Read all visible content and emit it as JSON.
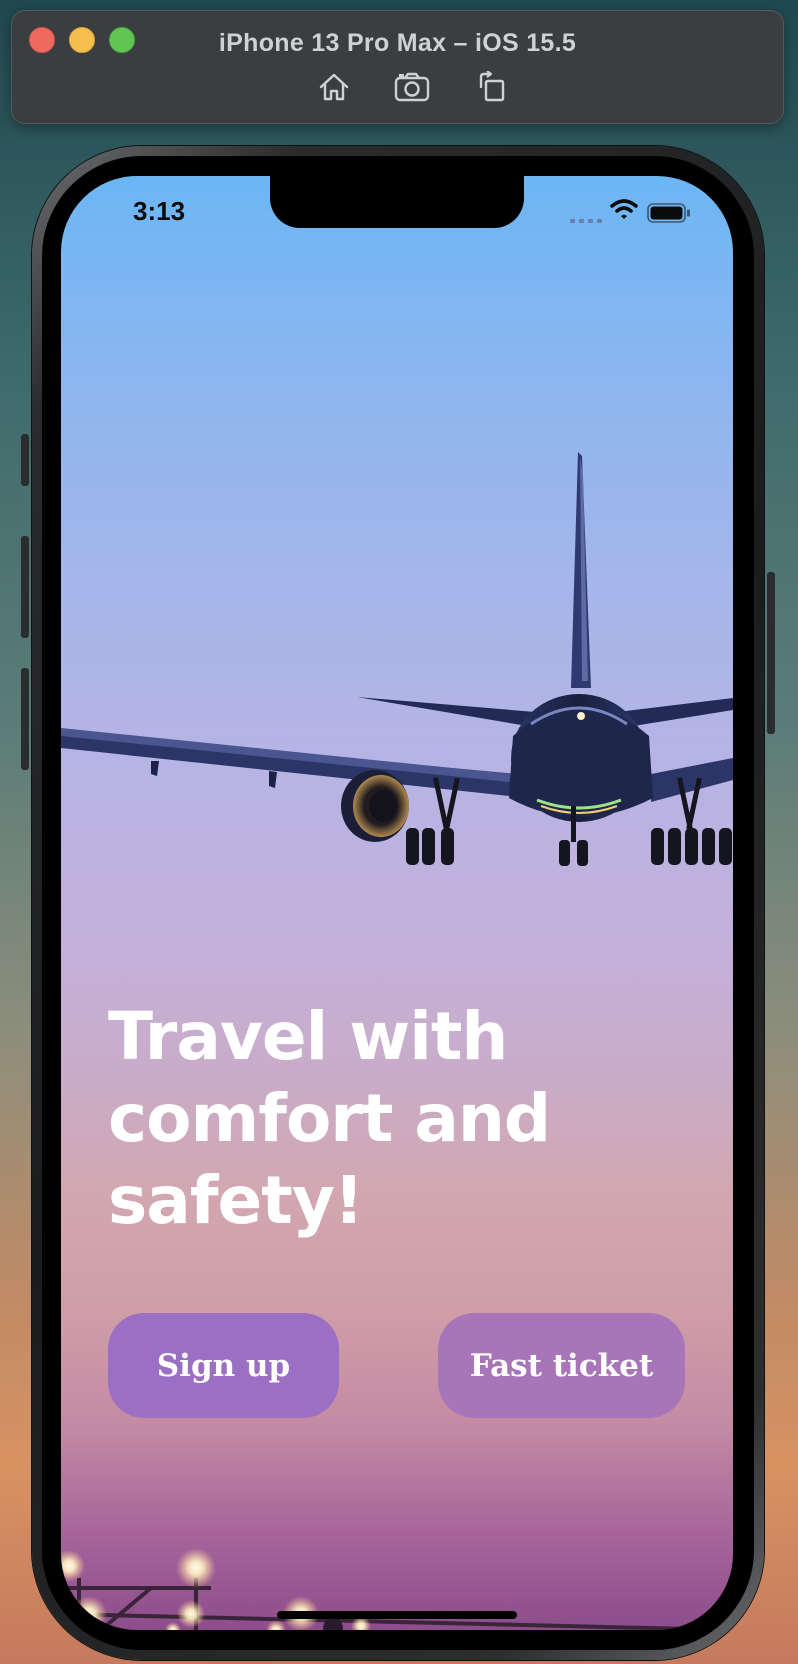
{
  "simulator": {
    "title": "iPhone 13 Pro Max – iOS 15.5",
    "toolbar": [
      {
        "name": "home",
        "icon": "home-icon"
      },
      {
        "name": "screenshot",
        "icon": "camera-icon"
      },
      {
        "name": "rotate",
        "icon": "rotate-icon"
      }
    ],
    "window_controls": [
      "close",
      "minimize",
      "maximize"
    ]
  },
  "status_bar": {
    "time": "3:13",
    "icons": [
      "cellular-signal-icon",
      "wifi-icon",
      "battery-icon"
    ]
  },
  "hero": {
    "headline_lines": [
      "Travel with",
      "comfort and",
      "safety!"
    ]
  },
  "actions": {
    "signup_label": "Sign up",
    "fast_ticket_label": "Fast ticket"
  },
  "colors": {
    "signup_button": "#9a6fc4",
    "fast_ticket_button": "#a876b8",
    "headline_text": "#ffffff",
    "sky_top": "#6bb6f4",
    "sky_bottom": "#8d4d8c"
  }
}
